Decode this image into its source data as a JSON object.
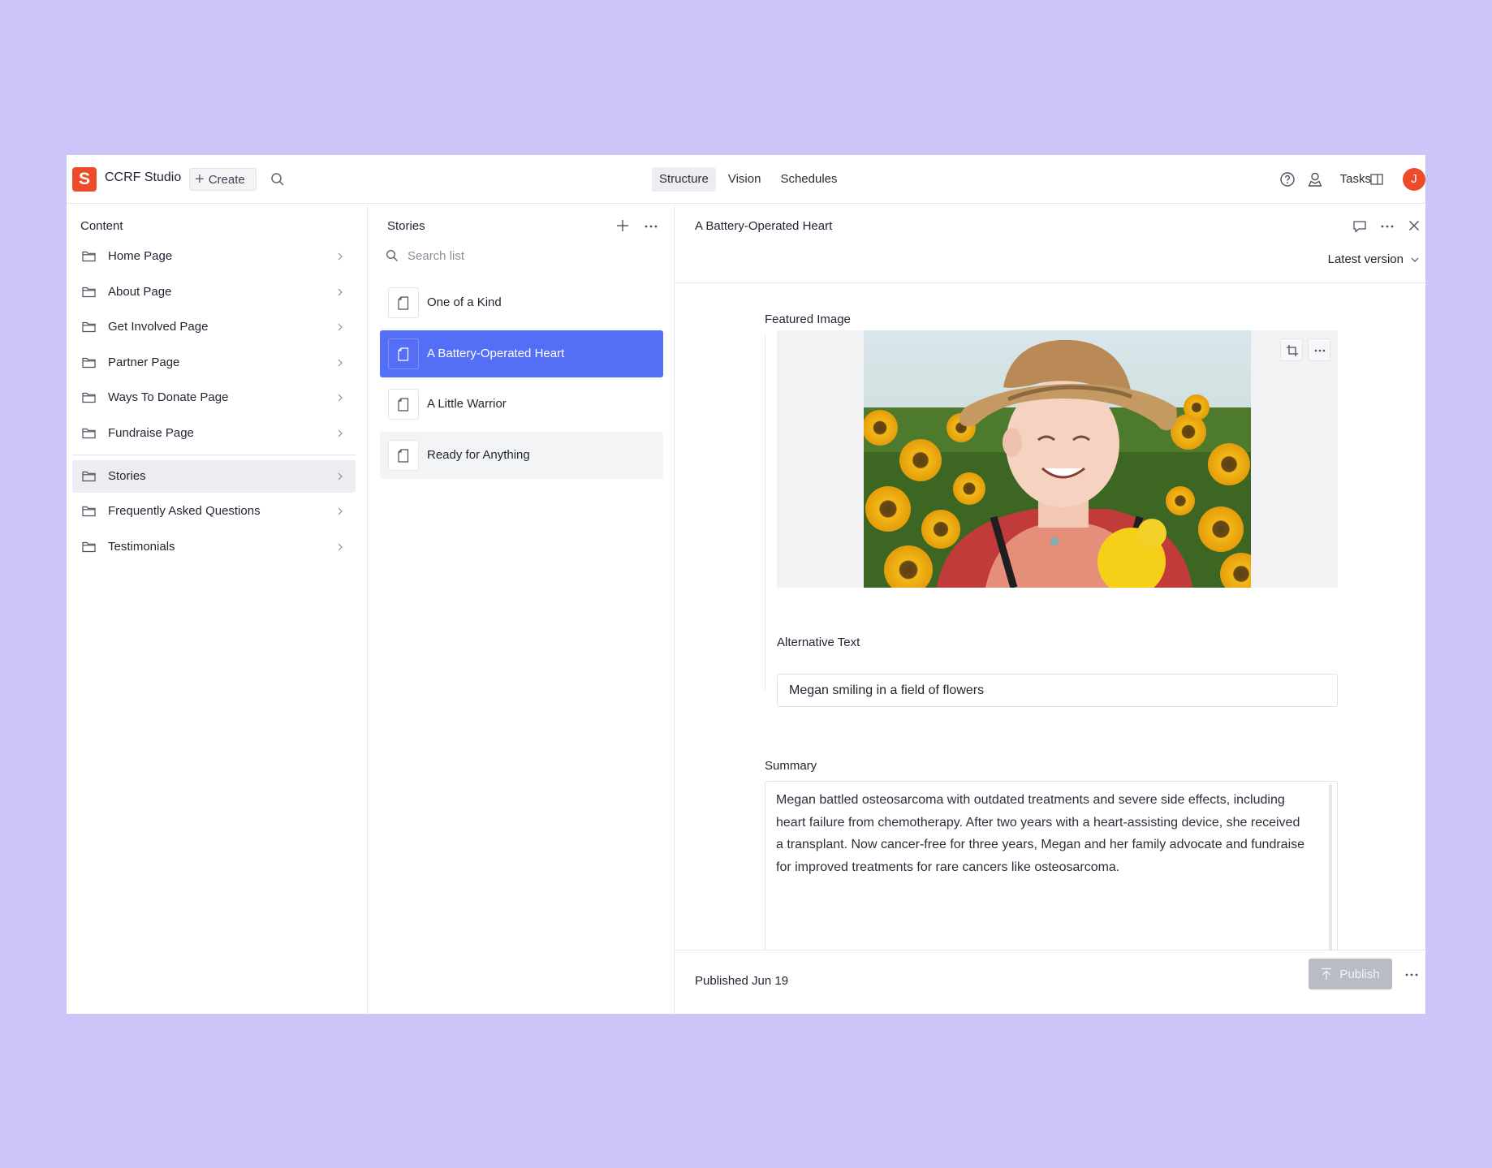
{
  "app": {
    "logo_letter": "S",
    "name": "CCRF Studio",
    "create_label": "Create",
    "accent": "#ee4b2b"
  },
  "nav": {
    "tabs": [
      {
        "label": "Structure",
        "active": true
      },
      {
        "label": "Vision",
        "active": false
      },
      {
        "label": "Schedules",
        "active": false
      }
    ]
  },
  "topbar_right": {
    "tasks_label": "Tasks",
    "avatar_letter": "J",
    "icons": [
      "help-icon",
      "user-icon",
      "panel-icon"
    ]
  },
  "content_pane": {
    "title": "Content",
    "items": [
      {
        "label": "Home Page"
      },
      {
        "label": "About Page"
      },
      {
        "label": "Get Involved Page"
      },
      {
        "label": "Partner Page"
      },
      {
        "label": "Ways To Donate Page"
      },
      {
        "label": "Fundraise Page"
      },
      {
        "label": "Stories"
      },
      {
        "label": "Frequently Asked Questions"
      },
      {
        "label": "Testimonials"
      }
    ],
    "selected": "Stories"
  },
  "stories_pane": {
    "title": "Stories",
    "search_placeholder": "Search list",
    "items": [
      {
        "label": "One of a Kind"
      },
      {
        "label": "A Battery-Operated Heart"
      },
      {
        "label": "A Little Warrior"
      },
      {
        "label": "Ready for Anything"
      }
    ],
    "selected": "A Battery-Operated Heart",
    "selected_color": "#556ef6"
  },
  "document": {
    "title": "A Battery-Operated Heart",
    "version_label": "Latest version",
    "featured_image_label": "Featured Image",
    "alt_text_label": "Alternative Text",
    "alt_text_value": "Megan smiling in a field of flowers",
    "summary_label": "Summary",
    "summary_value": "Megan battled osteosarcoma with outdated treatments and severe side effects, including heart failure from chemotherapy. After two years with a heart-assisting device, she received a transplant. Now cancer-free for three years, Megan and her family advocate and fundraise for improved treatments for rare cancers like osteosarcoma.",
    "status": "Published Jun 19",
    "publish_label": "Publish"
  }
}
